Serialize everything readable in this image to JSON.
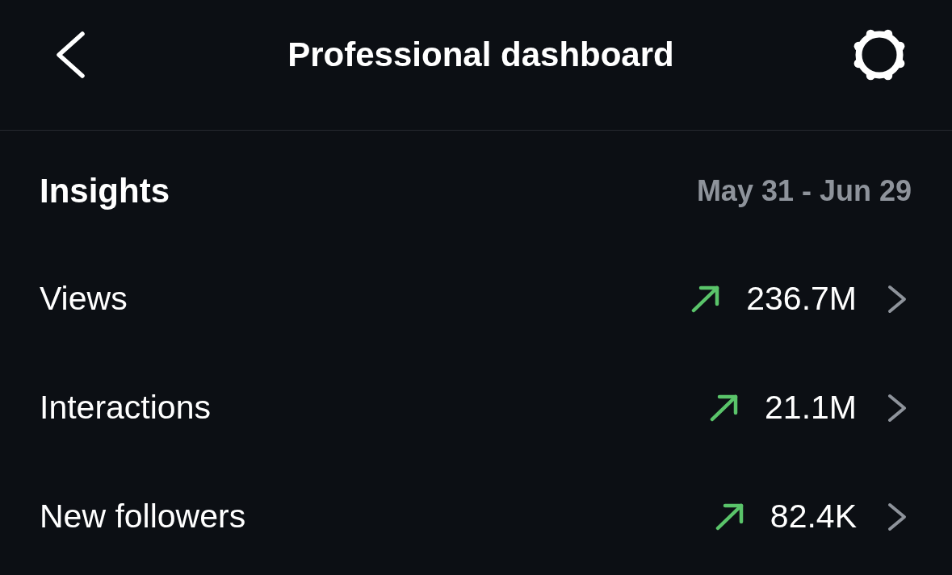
{
  "header": {
    "title": "Professional dashboard"
  },
  "insights": {
    "title": "Insights",
    "date_range": "May 31 - Jun 29"
  },
  "metrics": [
    {
      "label": "Views",
      "value": "236.7M",
      "rising": true
    },
    {
      "label": "Interactions",
      "value": "21.1M",
      "rising": true
    },
    {
      "label": "New followers",
      "value": "82.4K",
      "rising": true
    }
  ]
}
